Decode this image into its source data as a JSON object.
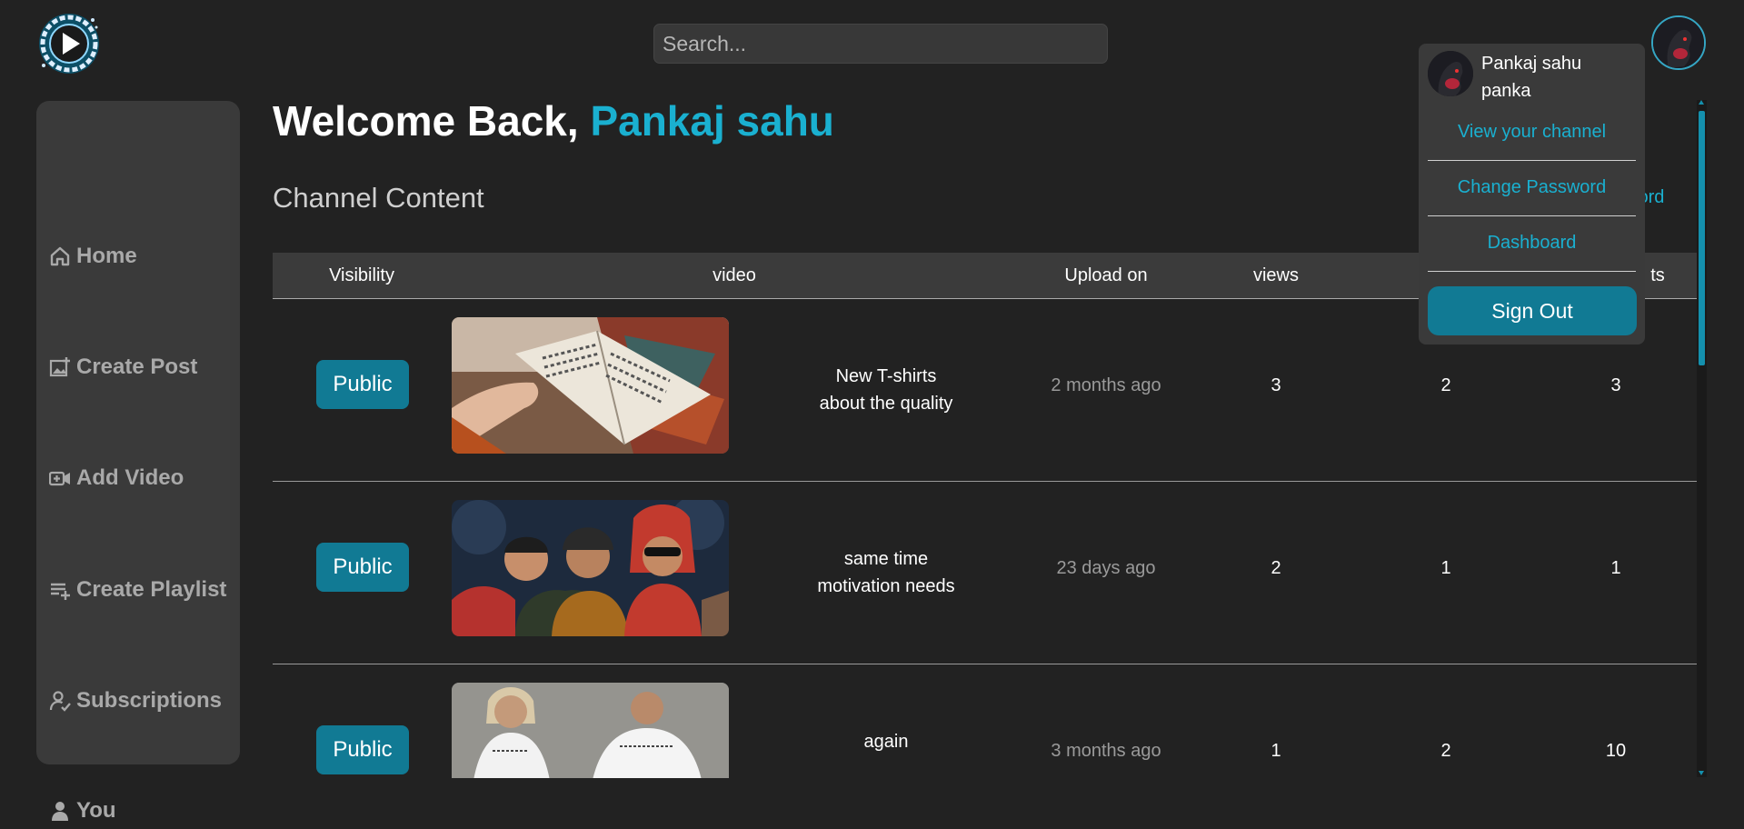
{
  "search": {
    "placeholder": "Search..."
  },
  "sidebar": {
    "items": [
      {
        "label": "Home",
        "icon": "home-icon"
      },
      {
        "label": "Create Post",
        "icon": "image-plus-icon"
      },
      {
        "label": "Add Video",
        "icon": "video-plus-icon"
      },
      {
        "label": "Create Playlist",
        "icon": "playlist-add-icon"
      },
      {
        "label": "Subscriptions",
        "icon": "user-check-icon"
      },
      {
        "label": "You",
        "icon": "user-icon"
      }
    ]
  },
  "welcome": {
    "prefix": "Welcome Back,",
    "name": "Pankaj sahu"
  },
  "content": {
    "section_title": "Channel Content",
    "background_link": "sword"
  },
  "table": {
    "headers": [
      "Visibility",
      "video",
      "Upload on",
      "views",
      "ts"
    ],
    "rows": [
      {
        "visibility": "Public",
        "title_line1": "New T-shirts",
        "title_line2": "about the quality",
        "uploaded": "2 months ago",
        "views": "3",
        "col5": "2",
        "col6": "3",
        "thumb": "book-reading"
      },
      {
        "visibility": "Public",
        "title_line1": "same time",
        "title_line2": "motivation needs",
        "uploaded": "23 days ago",
        "views": "2",
        "col5": "1",
        "col6": "1",
        "thumb": "illustrated-group"
      },
      {
        "visibility": "Public",
        "title_line1": "again",
        "title_line2": "",
        "uploaded": "3 months ago",
        "views": "1",
        "col5": "2",
        "col6": "10",
        "thumb": "white-tshirts"
      }
    ]
  },
  "dropdown": {
    "name": "Pankaj sahu",
    "username": "panka",
    "links": [
      "View your channel",
      "Change Password",
      "Dashboard"
    ],
    "signout": "Sign Out"
  },
  "colors": {
    "accent": "#1ab0d0",
    "button": "#117a94",
    "background": "#222222",
    "panel": "#3a3a3a"
  }
}
